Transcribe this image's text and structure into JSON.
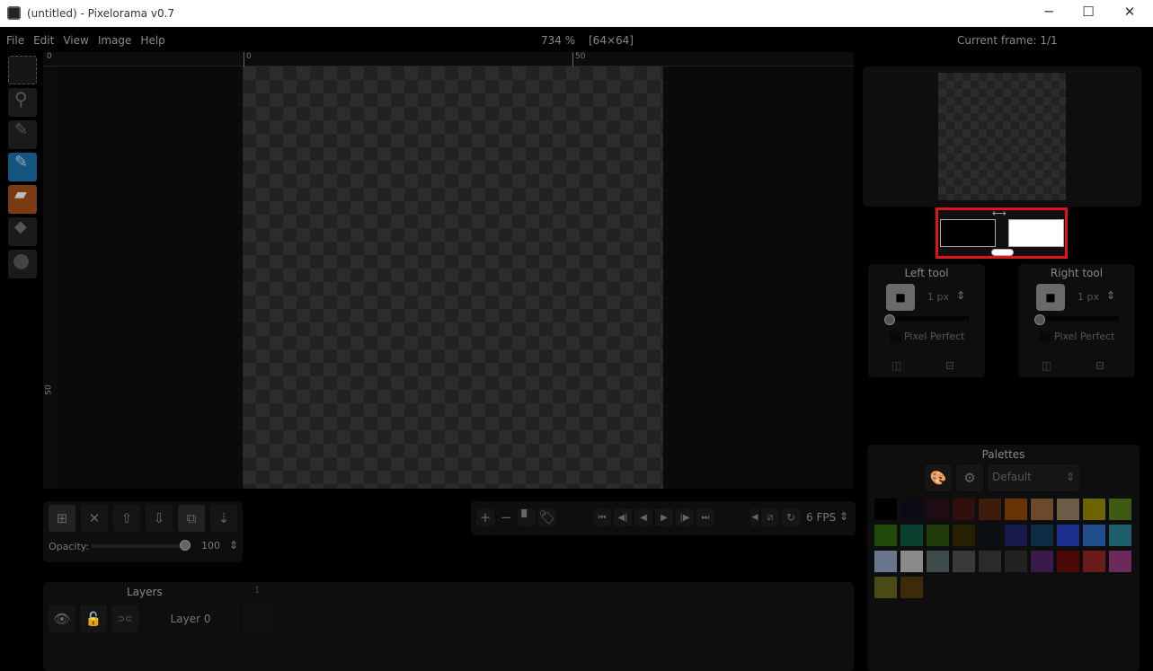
{
  "window": {
    "title": "(untitled) - Pixelorama v0.7",
    "minimize": "─",
    "maximize": "☐",
    "close": "✕"
  },
  "menu": [
    "File",
    "Edit",
    "View",
    "Image",
    "Help"
  ],
  "status": {
    "zoom": "734 %",
    "size": "[64×64]",
    "current_frame": "Current frame: 1/1"
  },
  "rulers": {
    "h_labels": [
      "0",
      "0",
      "50"
    ],
    "v_labels": [
      "50"
    ]
  },
  "tools": [
    "rect-select",
    "zoom",
    "color-picker",
    "pencil",
    "eraser",
    "bucket",
    "lighten-darken"
  ],
  "left_tool": {
    "title": "Left tool",
    "size": "1 px",
    "pixel_perfect": "Pixel Perfect"
  },
  "right_tool": {
    "title": "Right tool",
    "size": "1 px",
    "pixel_perfect": "Pixel Perfect"
  },
  "colors": {
    "left": "#000000",
    "right": "#ffffff",
    "highlight": "#e0141e"
  },
  "layers": {
    "opacity_label": "Opacity:",
    "opacity": "100",
    "title": "Layers",
    "frame_number": "1",
    "layer_name": "Layer 0"
  },
  "animation": {
    "fps": "6 FPS"
  },
  "palettes": {
    "title": "Palettes",
    "selected": "Default",
    "swatches": [
      "#000000",
      "#0d0a14",
      "#1e0b13",
      "#2e0f0b",
      "#3e1c0d",
      "#6a3305",
      "#6b4a2b",
      "#6d5b4a",
      "#6b6400",
      "#3d5b12",
      "#1f4a08",
      "#0b4030",
      "#1f3a08",
      "#251f03",
      "#0b0f12",
      "#151a4a",
      "#0d2d45",
      "#1d3090",
      "#1f4d8e",
      "#1f5f6b",
      "#6a7590",
      "#8a8a8a",
      "#3d4a4a",
      "#3a3a3a",
      "#2a2a2a",
      "#1f221e",
      "#3a1a4a",
      "#4d0808",
      "#6b1a1a",
      "#6b2a5b",
      "#4a4a15",
      "#3d2a0a"
    ]
  }
}
